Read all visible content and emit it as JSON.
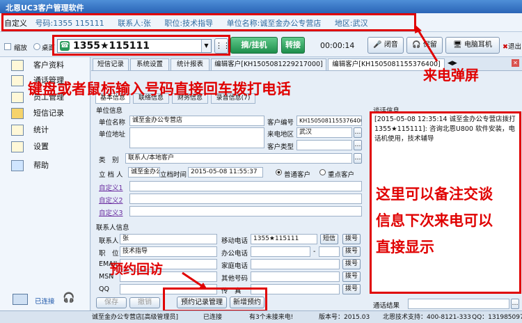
{
  "app": {
    "title": "北恩UC3客户管理软件"
  },
  "infobar": {
    "customize": "自定义",
    "phone_label": "号码:",
    "phone_value": "1355 115111",
    "contact_label": "联系人:",
    "contact_value": "张",
    "position_label": "职位:",
    "position_value": "技术指导",
    "company_label": "单位名称:",
    "company_value": "诚至金办公专营店",
    "region_label": "地区:",
    "region_value": "武汉"
  },
  "toolbar": {
    "shrink": "缩放",
    "desktop": "桌面",
    "dial_number": "1355★115111",
    "hangup": "摘/挂机",
    "transfer": "转接",
    "timer": "00:00:14",
    "mute": "闭音",
    "hold": "保留",
    "headset": "电脑耳机",
    "exit": "退出"
  },
  "sidebar": {
    "items": [
      {
        "label": "客户资料"
      },
      {
        "label": "通话管理"
      },
      {
        "label": "员工管理"
      },
      {
        "label": "短信记录"
      },
      {
        "label": "统计"
      },
      {
        "label": "设置"
      },
      {
        "label": "帮助"
      }
    ],
    "connected": "已连接"
  },
  "tabs": [
    {
      "label": "短信记录"
    },
    {
      "label": "系统设置"
    },
    {
      "label": "统计报表"
    },
    {
      "label": "编辑客户[KH1505081229217000]"
    },
    {
      "label": "编辑客户[KH1505081155376400]"
    }
  ],
  "subtabs": [
    {
      "label": "基本信息"
    },
    {
      "label": "联络信息"
    },
    {
      "label": "财务信息"
    },
    {
      "label": "录音信息(7)"
    }
  ],
  "form": {
    "unit_section": "单位信息",
    "unit_name_label": "单位名称",
    "unit_name": "诚至金办公专营店",
    "cust_no_label": "客户编号",
    "cust_no": "KH1505081155376400",
    "unit_addr_label": "单位地址",
    "call_region_label": "来电地区",
    "call_region": "武汉",
    "cust_type_label": "客户类型",
    "category_label": "类　别",
    "category": "联系人/本地客户",
    "creator_label": "立 档 人",
    "creator": "诚至金办公",
    "created_label": "立档时间",
    "created": "2015-05-08 11:55:37",
    "normal": "普通客户",
    "key": "重点客户",
    "custom1": "自定义1",
    "custom2": "自定义2",
    "custom3": "自定义3",
    "contact_section": "联系人信息",
    "contact_label": "联系人",
    "contact": "张",
    "mobile_label": "移动电话",
    "mobile": "1355★115111",
    "sms": "短信",
    "dial": "拨号",
    "pos_label": "职　位",
    "pos": "技术指导",
    "office_label": "办公电话",
    "dash": "-",
    "email_label": "EMAIL",
    "home_label": "家庭电话",
    "msn_label": "MSN",
    "other_label": "其他号码",
    "qq_label": "QQ",
    "fax_label": "传　真",
    "save": "保存",
    "cancel": "撤销",
    "appt_mgmt": "预约记录管理",
    "new_appt": "新增预约"
  },
  "talk": {
    "title": "谈话信息",
    "content": "[2015-05-08 12:35:14 诚至金办公专营店拨打　1355★115111]: 咨询北恩U800 软件安装，电话机使用，技术辅导",
    "result_label": "通话结果"
  },
  "status": {
    "s1": "诚至金办公专营店[高级管理员]",
    "s2": "已连接",
    "s3": "有3个未接来电!",
    "s4": "版本号：2015.03",
    "s5": "北恩技术支持：400-8121-333",
    "s6": "QQ：1319850974"
  },
  "annotations": {
    "incoming_popup": "来电弹屏",
    "dial_hint": "键盘或者鼠标输入号码直接回车拨打电话",
    "note_hint_1": "这里可以备注交谈",
    "note_hint_2": "信息下次来电可以",
    "note_hint_3": "直接显示",
    "appt_hint": "预约回访"
  },
  "colors": {
    "annotation": "#e00000",
    "accent": "#2a64b6"
  }
}
